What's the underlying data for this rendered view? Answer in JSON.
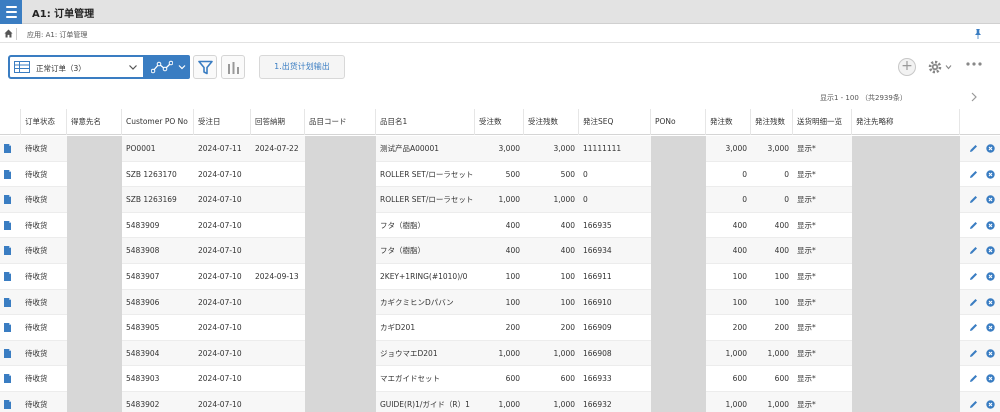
{
  "app": {
    "title": "A1: 订单管理",
    "breadcrumb": "应用: A1: 订单管理"
  },
  "toolbar": {
    "view_label": "正常订单（3）",
    "export_label": "1.出货计划输出"
  },
  "paging": {
    "info": "显示1 - 100 （共2939条）"
  },
  "colors": {
    "accent": "#3a7dc2",
    "masked": "#d7d7d7"
  },
  "table": {
    "headers": [
      "订单状态",
      "得意先名",
      "Customer PO No",
      "受注日",
      "回答納期",
      "品目コード",
      "品目名1",
      "受注数",
      "受注残数",
      "発注SEQ",
      "PONo",
      "発注数",
      "発注残数",
      "送货明细一览",
      "発注先略称"
    ],
    "rows": [
      {
        "status": "待收货",
        "po": "PO0001",
        "order_date": "2024-07-11",
        "reply_date": "2024-07-22",
        "item_name": "测试产品A00001",
        "qty": "3,000",
        "remain": "3,000",
        "seq": "11111111",
        "order_qty": "3,000",
        "order_remain": "3,000",
        "detail": "显示*"
      },
      {
        "status": "待收货",
        "po": "SZB 1263170",
        "order_date": "2024-07-10",
        "reply_date": "",
        "item_name": "ROLLER SET/ローラセット",
        "qty": "500",
        "remain": "500",
        "seq": "0",
        "order_qty": "0",
        "order_remain": "0",
        "detail": "显示*"
      },
      {
        "status": "待收货",
        "po": "SZB 1263169",
        "order_date": "2024-07-10",
        "reply_date": "",
        "item_name": "ROLLER SET/ローラセット",
        "qty": "1,000",
        "remain": "1,000",
        "seq": "0",
        "order_qty": "0",
        "order_remain": "0",
        "detail": "显示*"
      },
      {
        "status": "待收货",
        "po": "5483909",
        "order_date": "2024-07-10",
        "reply_date": "",
        "item_name": "フタ（樹脂）",
        "qty": "400",
        "remain": "400",
        "seq": "166935",
        "order_qty": "400",
        "order_remain": "400",
        "detail": "显示*"
      },
      {
        "status": "待收货",
        "po": "5483908",
        "order_date": "2024-07-10",
        "reply_date": "",
        "item_name": "フタ（樹脂）",
        "qty": "400",
        "remain": "400",
        "seq": "166934",
        "order_qty": "400",
        "order_remain": "400",
        "detail": "显示*"
      },
      {
        "status": "待收货",
        "po": "5483907",
        "order_date": "2024-07-10",
        "reply_date": "2024-09-13",
        "item_name": "2KEY+1RING(#1010)/0",
        "qty": "100",
        "remain": "100",
        "seq": "166911",
        "order_qty": "100",
        "order_remain": "100",
        "detail": "显示*"
      },
      {
        "status": "待收货",
        "po": "5483906",
        "order_date": "2024-07-10",
        "reply_date": "",
        "item_name": "カギクミヒンDパバン",
        "qty": "100",
        "remain": "100",
        "seq": "166910",
        "order_qty": "100",
        "order_remain": "100",
        "detail": "显示*"
      },
      {
        "status": "待收货",
        "po": "5483905",
        "order_date": "2024-07-10",
        "reply_date": "",
        "item_name": "カギD201",
        "qty": "200",
        "remain": "200",
        "seq": "166909",
        "order_qty": "200",
        "order_remain": "200",
        "detail": "显示*"
      },
      {
        "status": "待收货",
        "po": "5483904",
        "order_date": "2024-07-10",
        "reply_date": "",
        "item_name": "ジョウマエD201",
        "qty": "1,000",
        "remain": "1,000",
        "seq": "166908",
        "order_qty": "1,000",
        "order_remain": "1,000",
        "detail": "显示*"
      },
      {
        "status": "待收货",
        "po": "5483903",
        "order_date": "2024-07-10",
        "reply_date": "",
        "item_name": "マエガイドセット",
        "qty": "600",
        "remain": "600",
        "seq": "166933",
        "order_qty": "600",
        "order_remain": "600",
        "detail": "显示*"
      },
      {
        "status": "待收货",
        "po": "5483902",
        "order_date": "2024-07-10",
        "reply_date": "",
        "item_name": "GUIDE(R)1/ガイド（R）1",
        "qty": "1,000",
        "remain": "1,000",
        "seq": "166932",
        "order_qty": "1,000",
        "order_remain": "1,000",
        "detail": "显示*"
      }
    ]
  }
}
